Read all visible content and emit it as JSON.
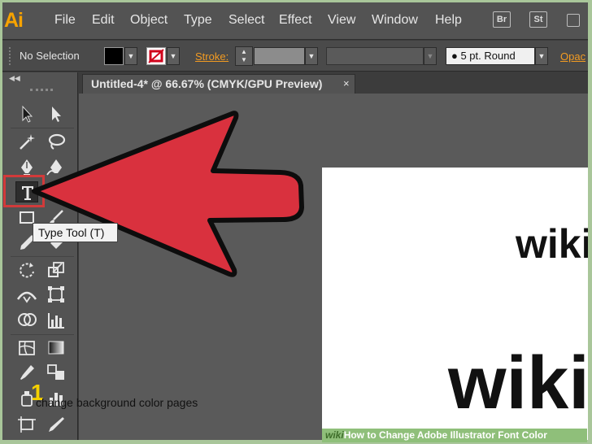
{
  "app": {
    "logo": "Ai"
  },
  "menu": [
    "File",
    "Edit",
    "Object",
    "Type",
    "Select",
    "Effect",
    "View",
    "Window",
    "Help"
  ],
  "menu_boxes": [
    "Br",
    "St"
  ],
  "control_bar": {
    "selection_label": "No Selection",
    "stroke_label": "Stroke:",
    "brush_value": "5 pt. Round",
    "opacity_label": "Opac"
  },
  "document": {
    "tab_title": "Untitled-4* @ 66.67% (CMYK/GPU Preview)",
    "close_glyph": "×"
  },
  "artboard": {
    "text_top": "wiki",
    "text_bottom": "wiki"
  },
  "tooltip": "Type Tool (T)",
  "tools": [
    "selection-tool-icon",
    "direct-selection-tool-icon",
    "magic-wand-tool-icon",
    "lasso-tool-icon",
    "pen-tool-icon",
    "curvature-pen-tool-icon",
    "type-tool-icon",
    "rectangle-tool-icon",
    "paintbrush-tool-icon",
    "pencil-tool-icon",
    "eraser-tool-icon",
    "rotate-tool-icon",
    "scale-tool-icon",
    "width-tool-icon",
    "free-transform-tool-icon",
    "shape-builder-tool-icon",
    "graph-tool-icon",
    "mesh-tool-icon",
    "gradient-tool-icon",
    "eyedropper-tool-icon",
    "blend-tool-icon",
    "symbol-sprayer-tool-icon",
    "column-graph-tool-icon",
    "artboard-tool-icon",
    "slice-tool-icon"
  ],
  "caption": {
    "number": "1",
    "text": "change background color pages"
  },
  "watermark": {
    "brand": "wiki",
    "text": "How to Change Adobe Illustrator Font Color"
  },
  "colors": {
    "arrow": "#d9313e",
    "highlight": "#d23a3a",
    "accent": "#f29b22",
    "logo": "#f7a300"
  }
}
